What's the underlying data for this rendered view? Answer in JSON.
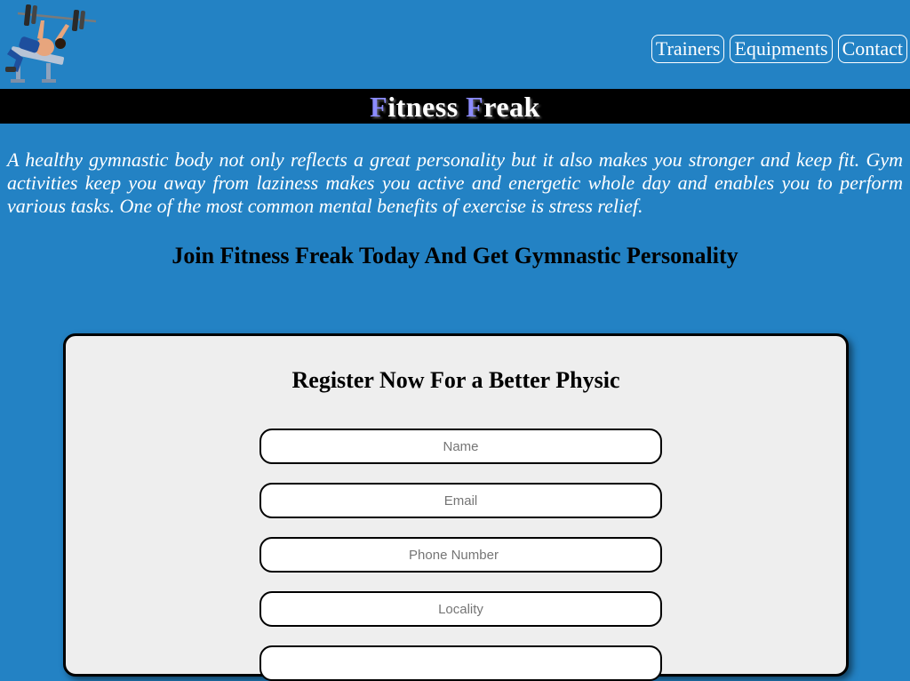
{
  "header": {
    "logo_icon": "weightlifter-bench-press-icon",
    "nav": [
      {
        "label": "Trainers"
      },
      {
        "label": "Equipments"
      },
      {
        "label": "Contact"
      }
    ]
  },
  "title": {
    "first_letter_1": "F",
    "rest_1": "itness",
    "first_letter_2": "F",
    "rest_2": "reak"
  },
  "intro": {
    "text": "A healthy gymnastic body not only reflects a great personality but it also makes you stronger and keep fit. Gym activities keep you away from laziness makes you active and energetic whole day and enables you to perform various tasks. One of the most common mental benefits of exercise is stress relief."
  },
  "tagline": "Join Fitness Freak Today And Get Gymnastic Personality",
  "form": {
    "title": "Register Now For a Better Physic",
    "fields": [
      {
        "placeholder": "Name"
      },
      {
        "placeholder": "Email"
      },
      {
        "placeholder": "Phone Number"
      },
      {
        "placeholder": "Locality"
      },
      {
        "placeholder": ""
      }
    ]
  },
  "colors": {
    "background": "#2382c4",
    "title_bar": "#000000",
    "accent_letter": "#8c8cff",
    "card": "#eeeeee"
  }
}
